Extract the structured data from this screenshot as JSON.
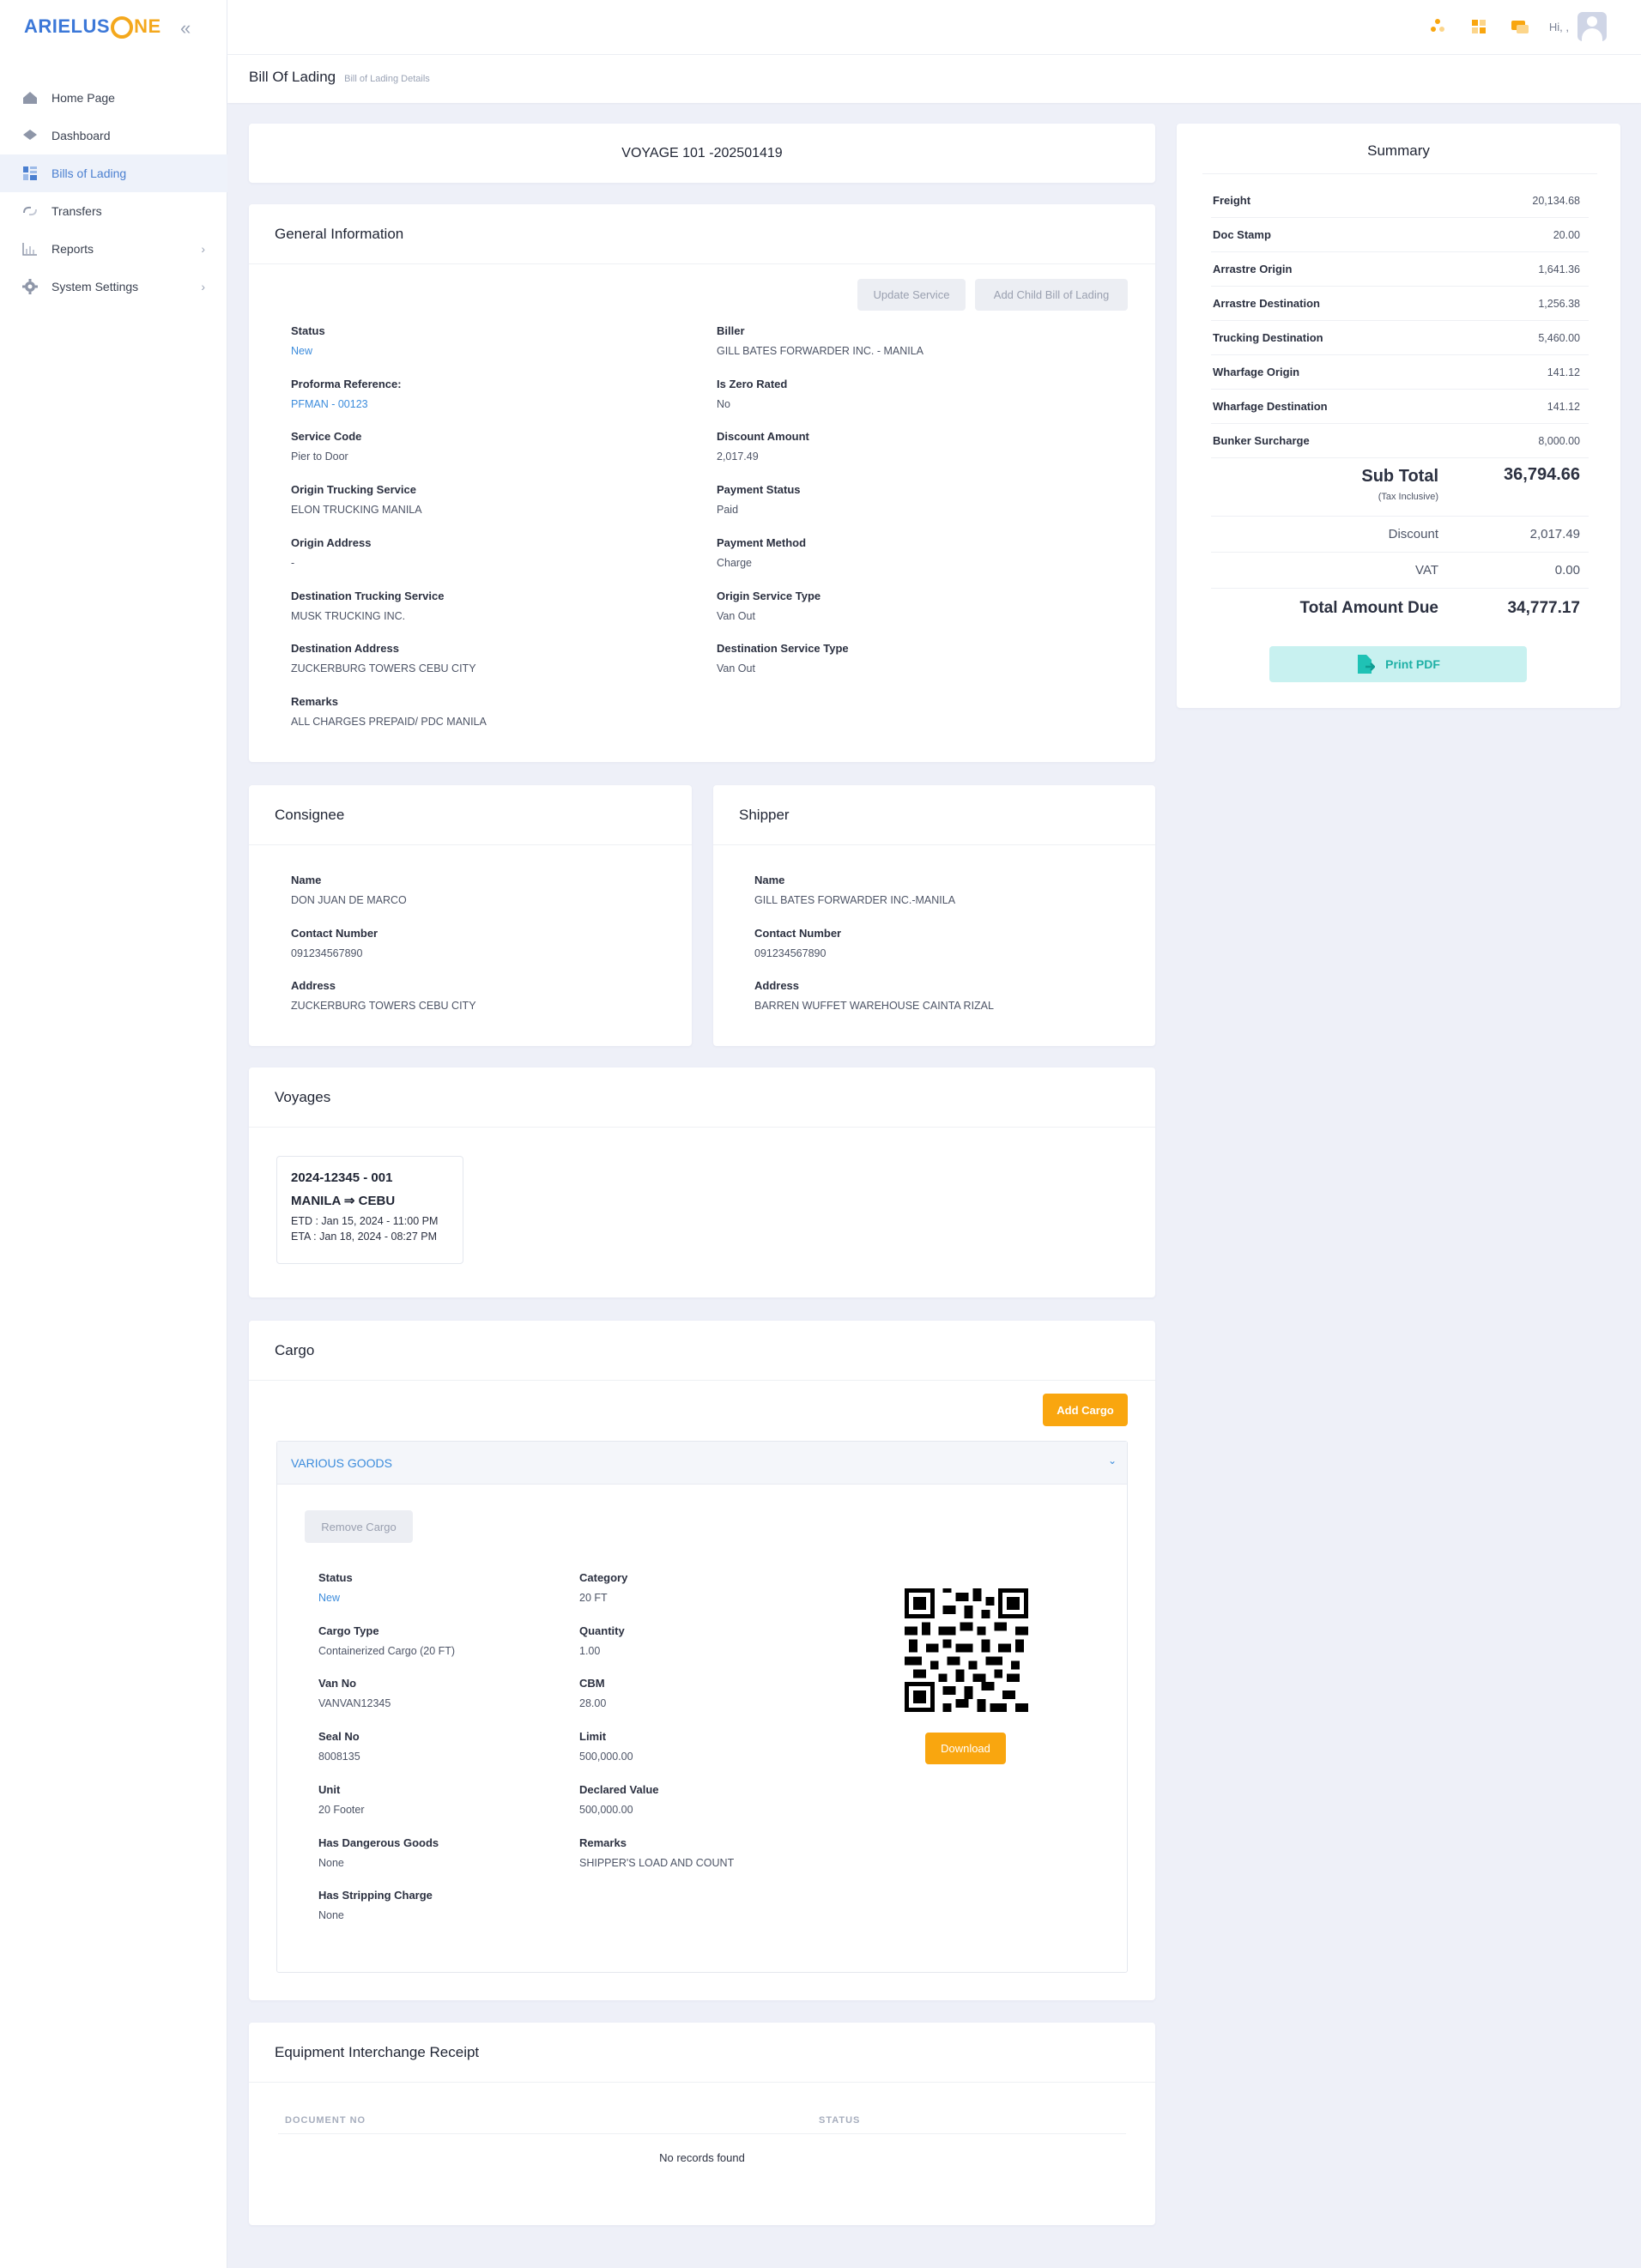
{
  "brand": {
    "part1": "ARIELUS",
    "part2": "NE"
  },
  "sidebar": {
    "items": [
      {
        "label": "Home Page"
      },
      {
        "label": "Dashboard"
      },
      {
        "label": "Bills of Lading"
      },
      {
        "label": "Transfers"
      },
      {
        "label": "Reports"
      },
      {
        "label": "System Settings"
      }
    ]
  },
  "topbar": {
    "greeting": "Hi, ,"
  },
  "breadcrumb": {
    "title": "Bill Of Lading",
    "sub": "Bill of Lading Details"
  },
  "voyage_header": "VOYAGE 101 -202501419",
  "general": {
    "title": "General Information",
    "update_service": "Update Service",
    "add_child": "Add Child Bill of Lading",
    "left": [
      {
        "label": "Status",
        "value": "New"
      },
      {
        "label": "Proforma Reference:",
        "value": "PFMAN - 00123"
      },
      {
        "label": "Service Code",
        "value": "Pier to Door"
      },
      {
        "label": "Origin Trucking Service",
        "value": "ELON TRUCKING MANILA"
      },
      {
        "label": "Origin Address",
        "value": "-"
      },
      {
        "label": "Destination Trucking Service",
        "value": "MUSK TRUCKING INC."
      },
      {
        "label": "Destination Address",
        "value": "ZUCKERBURG TOWERS CEBU CITY"
      },
      {
        "label": "Remarks",
        "value": "ALL CHARGES PREPAID/ PDC MANILA"
      }
    ],
    "right": [
      {
        "label": "Biller",
        "value": "GILL BATES FORWARDER INC. - MANILA"
      },
      {
        "label": "Is Zero Rated",
        "value": "No"
      },
      {
        "label": "Discount Amount",
        "value": "2,017.49"
      },
      {
        "label": "Payment Status",
        "value": "Paid"
      },
      {
        "label": "Payment Method",
        "value": "Charge"
      },
      {
        "label": "Origin Service Type",
        "value": "Van Out"
      },
      {
        "label": "Destination Service Type",
        "value": "Van Out"
      }
    ]
  },
  "consignee": {
    "title": "Consignee",
    "fields": [
      {
        "label": "Name",
        "value": "DON JUAN DE MARCO"
      },
      {
        "label": "Contact Number",
        "value": "091234567890"
      },
      {
        "label": "Address",
        "value": "ZUCKERBURG TOWERS CEBU CITY"
      }
    ]
  },
  "shipper": {
    "title": "Shipper",
    "fields": [
      {
        "label": "Name",
        "value": "GILL BATES FORWARDER INC.-MANILA"
      },
      {
        "label": "Contact Number",
        "value": "091234567890"
      },
      {
        "label": "Address",
        "value": "BARREN WUFFET WAREHOUSE CAINTA RIZAL"
      }
    ]
  },
  "voyages": {
    "title": "Voyages",
    "items": [
      {
        "code": "2024-12345 - 001",
        "route": "MANILA ⇒ CEBU",
        "etd": "ETD : Jan 15, 2024 - 11:00 PM",
        "eta": "ETA : Jan 18, 2024 - 08:27 PM"
      }
    ]
  },
  "cargo": {
    "title": "Cargo",
    "add": "Add Cargo",
    "accordion_title": "VARIOUS GOODS",
    "remove": "Remove Cargo",
    "download": "Download",
    "left": [
      {
        "label": "Status",
        "value": "New"
      },
      {
        "label": "Cargo Type",
        "value": "Containerized Cargo (20 FT)"
      },
      {
        "label": "Van No",
        "value": "VANVAN12345"
      },
      {
        "label": "Seal No",
        "value": "8008135"
      },
      {
        "label": "Unit",
        "value": "20 Footer"
      },
      {
        "label": "Has Dangerous Goods",
        "value": "None"
      },
      {
        "label": "Has Stripping Charge",
        "value": "None"
      }
    ],
    "right": [
      {
        "label": "Category",
        "value": "20 FT"
      },
      {
        "label": "Quantity",
        "value": "1.00"
      },
      {
        "label": "CBM",
        "value": "28.00"
      },
      {
        "label": "Limit",
        "value": "500,000.00"
      },
      {
        "label": "Declared Value",
        "value": "500,000.00"
      },
      {
        "label": "Remarks",
        "value": "SHIPPER'S LOAD AND COUNT"
      }
    ]
  },
  "eir": {
    "title": "Equipment Interchange Receipt",
    "col1": "DOCUMENT NO",
    "col2": "STATUS",
    "empty": "No records found"
  },
  "summary": {
    "title": "Summary",
    "rows": [
      {
        "k": "Freight",
        "v": "20,134.68"
      },
      {
        "k": "Doc Stamp",
        "v": "20.00"
      },
      {
        "k": "Arrastre Origin",
        "v": "1,641.36"
      },
      {
        "k": "Arrastre Destination",
        "v": "1,256.38"
      },
      {
        "k": "Trucking Destination",
        "v": "5,460.00"
      },
      {
        "k": "Wharfage Origin",
        "v": "141.12"
      },
      {
        "k": "Wharfage Destination",
        "v": "141.12"
      },
      {
        "k": "Bunker Surcharge",
        "v": "8,000.00"
      }
    ],
    "subtotal_label": "Sub Total",
    "subtotal_note": "(Tax Inclusive)",
    "subtotal": "36,794.66",
    "discount_label": "Discount",
    "discount": "2,017.49",
    "vat_label": "VAT",
    "vat": "0.00",
    "total_label": "Total Amount Due",
    "total": "34,777.17",
    "print": "Print PDF"
  }
}
